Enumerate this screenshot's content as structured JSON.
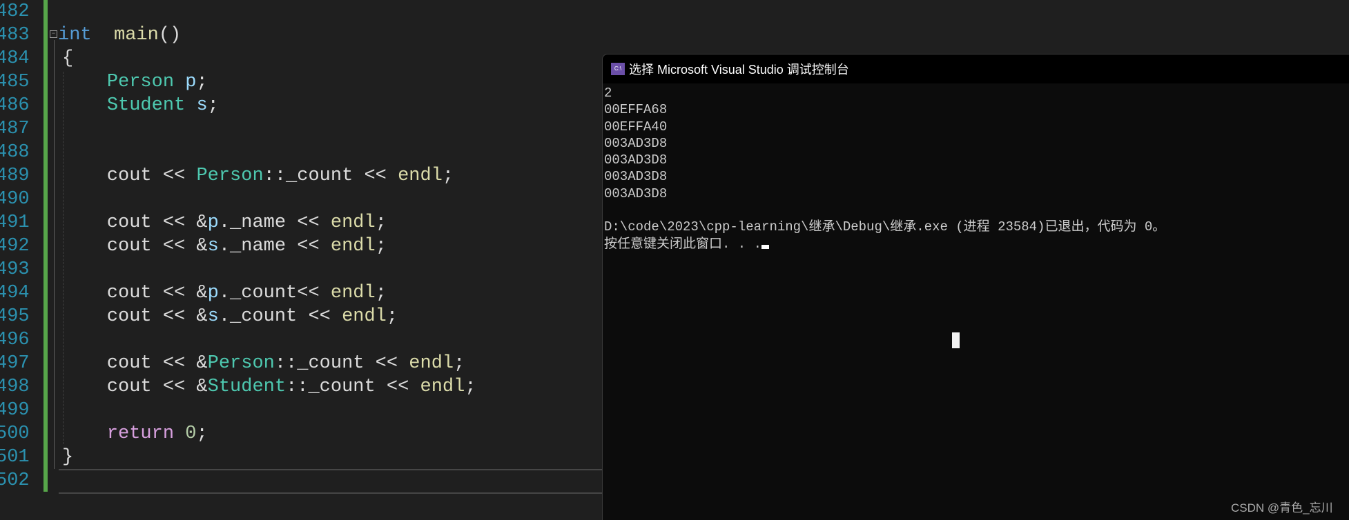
{
  "editor": {
    "line_numbers": [
      "482",
      "483",
      "484",
      "485",
      "486",
      "487",
      "488",
      "489",
      "490",
      "491",
      "492",
      "493",
      "494",
      "495",
      "496",
      "497",
      "498",
      "499",
      "500",
      "501",
      "502"
    ],
    "lines": [
      [],
      [
        [
          "kw",
          "int"
        ],
        [
          "",
          "  "
        ],
        [
          "fn",
          "main"
        ],
        [
          "",
          "()"
        ]
      ],
      [
        [
          "",
          "{"
        ]
      ],
      [
        [
          "",
          "    "
        ],
        [
          "ty",
          "Person"
        ],
        [
          "",
          " "
        ],
        [
          "va",
          "p"
        ],
        [
          "",
          ";"
        ]
      ],
      [
        [
          "",
          "    "
        ],
        [
          "ty",
          "Student"
        ],
        [
          "",
          " "
        ],
        [
          "va",
          "s"
        ],
        [
          "",
          ";"
        ]
      ],
      [],
      [],
      [
        [
          "",
          "    cout << "
        ],
        [
          "ty",
          "Person"
        ],
        [
          "",
          "::_count << "
        ],
        [
          "fn",
          "endl"
        ],
        [
          "",
          ";"
        ]
      ],
      [],
      [
        [
          "",
          "    cout << &"
        ],
        [
          "va",
          "p"
        ],
        [
          "",
          "._name << "
        ],
        [
          "fn",
          "endl"
        ],
        [
          "",
          ";"
        ]
      ],
      [
        [
          "",
          "    cout << &"
        ],
        [
          "va",
          "s"
        ],
        [
          "",
          "._name << "
        ],
        [
          "fn",
          "endl"
        ],
        [
          "",
          ";"
        ]
      ],
      [],
      [
        [
          "",
          "    cout << &"
        ],
        [
          "va",
          "p"
        ],
        [
          "",
          "._count<< "
        ],
        [
          "fn",
          "endl"
        ],
        [
          "",
          ";"
        ]
      ],
      [
        [
          "",
          "    cout << &"
        ],
        [
          "va",
          "s"
        ],
        [
          "",
          "._count << "
        ],
        [
          "fn",
          "endl"
        ],
        [
          "",
          ";"
        ]
      ],
      [],
      [
        [
          "",
          "    cout << &"
        ],
        [
          "ty",
          "Person"
        ],
        [
          "",
          "::_count << "
        ],
        [
          "fn",
          "endl"
        ],
        [
          "",
          ";"
        ]
      ],
      [
        [
          "",
          "    cout << &"
        ],
        [
          "ty",
          "Student"
        ],
        [
          "",
          "::_count << "
        ],
        [
          "fn",
          "endl"
        ],
        [
          "",
          ";"
        ]
      ],
      [],
      [
        [
          "",
          "    "
        ],
        [
          "rt",
          "return"
        ],
        [
          "",
          " "
        ],
        [
          "nu",
          "0"
        ],
        [
          "",
          ";"
        ]
      ],
      [
        [
          "",
          "}"
        ]
      ],
      []
    ]
  },
  "console": {
    "title": "选择 Microsoft Visual Studio 调试控制台",
    "icon": "C:\\",
    "output": "2\n00EFFA68\n00EFFA40\n003AD3D8\n003AD3D8\n003AD3D8\n003AD3D8\n\nD:\\code\\2023\\cpp-learning\\继承\\Debug\\继承.exe (进程 23584)已退出，代码为 0。\n按任意键关闭此窗口. . ."
  },
  "watermark": "CSDN @青色_忘川",
  "colors": {
    "editor_bg": "#1f1f1f",
    "console_bg": "#0c0c0c",
    "line_number": "#2b91af",
    "change_bar": "#57a64a"
  }
}
